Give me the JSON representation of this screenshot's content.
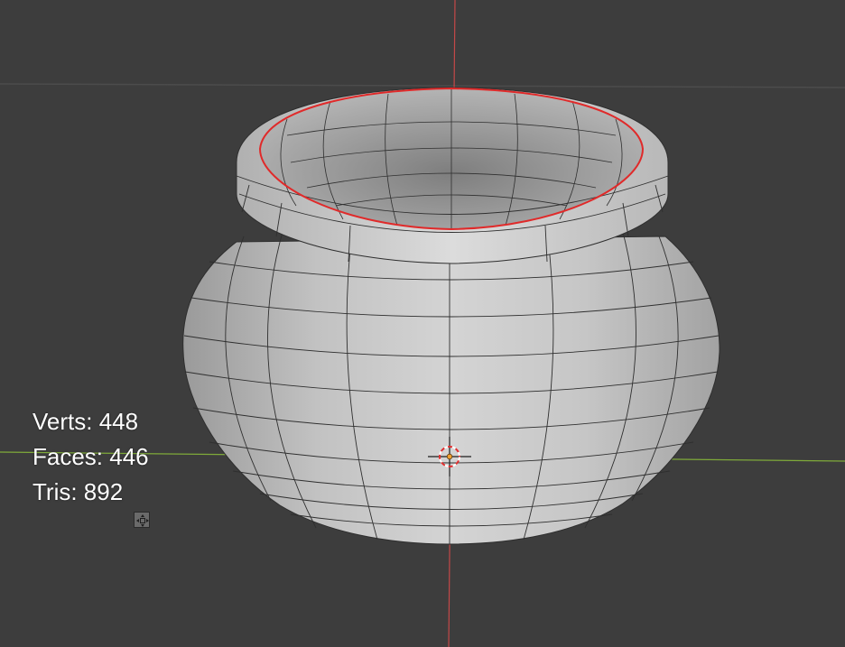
{
  "viewport": {
    "background_color": "#3d3d3d",
    "grid_line_color": "#4a4a4a",
    "x_axis_color": "#86b43a",
    "y_axis_color": "#d24a4a",
    "selection_color": "#e02a2a",
    "mesh_face_color": "#c8c8c8",
    "mesh_wire_color": "#2e2e2e",
    "object": "pot-mesh",
    "cursor_icon": "3d-cursor-icon"
  },
  "stats": {
    "verts_label": "Verts: 448",
    "faces_label": "Faces: 446",
    "tris_label": "Tris: 892"
  },
  "gizmo": {
    "icon": "view-navigation-icon"
  }
}
